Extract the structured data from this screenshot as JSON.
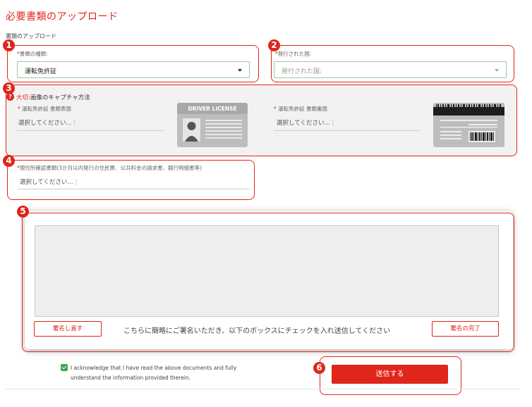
{
  "header": {
    "title": "必要書類のアップロード",
    "subtitle": "書類のアップロード"
  },
  "markers": [
    "1",
    "2",
    "3",
    "4",
    "5",
    "6"
  ],
  "doc_type": {
    "required_mark": "*",
    "label": "書類の種類:",
    "value": "運転免許証"
  },
  "country": {
    "required_mark": "*",
    "label": "発行された国:",
    "placeholder": "発行された国:"
  },
  "capture": {
    "help_icon": "?",
    "important": "大切:",
    "method_label": "画像のキャプチャ方法",
    "front": {
      "required_mark": "*",
      "label": "運転免許証 書類表面",
      "placeholder": "選択してください...",
      "card_title": "DRIVER LICENSE"
    },
    "back": {
      "required_mark": "*",
      "label": "運転免許証 書類裏面",
      "placeholder": "選択してください..."
    }
  },
  "residence": {
    "required_mark": "*",
    "label": "現住所確認書類(3か月以内発行の住民票、公共料金の請求書、銀行明細書等)",
    "placeholder": "選択してください..."
  },
  "signature": {
    "redo_label": "署名し直す",
    "instruction": "こちらに簡略にご署名いただき、以下のボックスにチェックを入れ送信してください",
    "complete_label": "署名の完了"
  },
  "acknowledge": {
    "checked": true,
    "text": "I acknowledge that I have read the above documents and fully understand the information provided therein."
  },
  "submit": {
    "label": "送信する"
  },
  "colors": {
    "accent": "#e0251b",
    "check": "#3aa551",
    "select_border": "#9cc9a0"
  }
}
